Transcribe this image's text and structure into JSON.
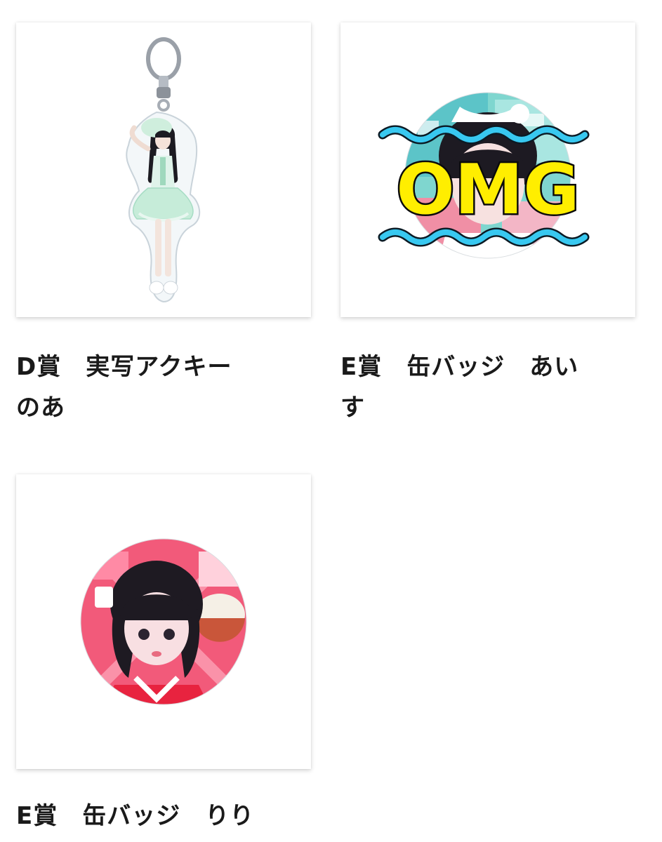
{
  "products": [
    {
      "title": "D賞　実写アクキー　のあ",
      "image": "acrylic-keychain-noa"
    },
    {
      "title": "E賞　缶バッジ　あいす",
      "image": "can-badge-aisu",
      "badge_text": "OMG"
    },
    {
      "title": "E賞　缶バッジ　りり",
      "image": "can-badge-riri"
    }
  ],
  "colors": {
    "omg_yellow": "#ffee00",
    "wave_blue": "#38c8f0",
    "mint": "#bfe8d4",
    "riri_red": "#e8335a"
  }
}
